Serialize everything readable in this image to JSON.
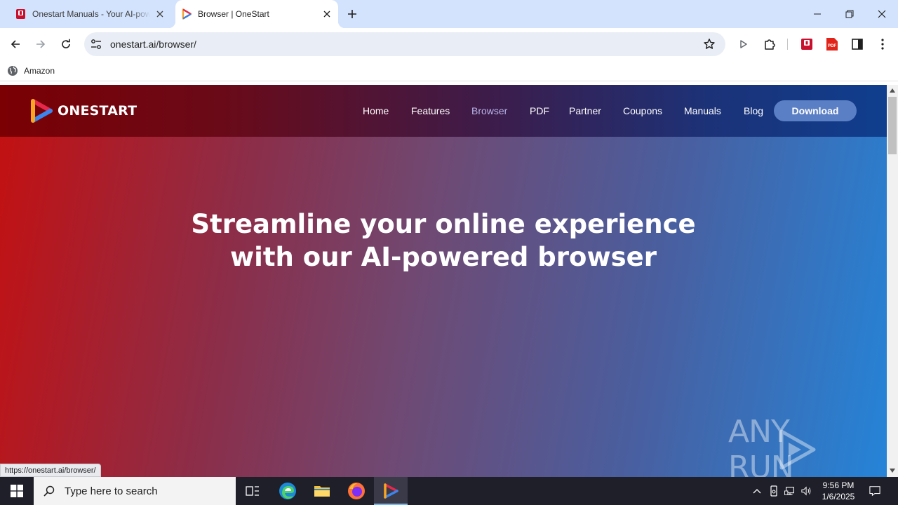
{
  "browser": {
    "tabs": [
      {
        "title": "Onestart Manuals - Your AI-powered",
        "active": false
      },
      {
        "title": "Browser | OneStart",
        "active": true
      }
    ],
    "address": "onestart.ai/browser/",
    "bookmarks": [
      {
        "label": "Amazon"
      }
    ],
    "status_url": "https://onestart.ai/browser/"
  },
  "site": {
    "logo_text": "ONESTART",
    "nav": [
      {
        "label": "Home"
      },
      {
        "label": "Features"
      },
      {
        "label": "Browser",
        "active": true
      },
      {
        "label": "PDF"
      },
      {
        "label": "Partner"
      },
      {
        "label": "Coupons"
      },
      {
        "label": "Manuals"
      },
      {
        "label": "Blog"
      }
    ],
    "download_label": "Download",
    "hero_line1": "Streamline your online experience",
    "hero_line2": "with our AI-powered browser",
    "watermark": "ANY RUN"
  },
  "taskbar": {
    "search_placeholder": "Type here to search",
    "time": "9:56 PM",
    "date": "1/6/2025"
  },
  "colors": {
    "tab_strip": "#d3e3fd",
    "download_button": "#5b7fc4",
    "active_nav": "#b9b5e8"
  }
}
